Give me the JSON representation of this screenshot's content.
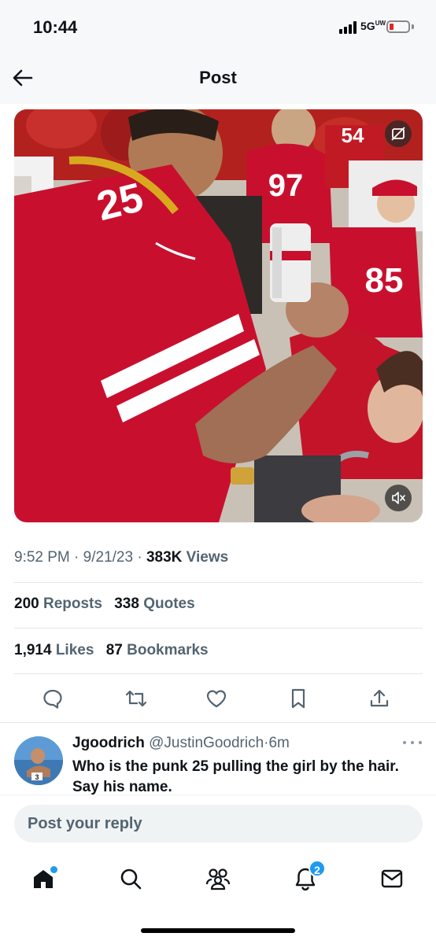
{
  "status_bar": {
    "time": "10:44",
    "network": "5G",
    "battery_level": 0.15
  },
  "header": {
    "title": "Post"
  },
  "post": {
    "media_text": {
      "jersey_main": "25",
      "jersey_97": "97",
      "jersey_54": "54",
      "jersey_85": "85"
    },
    "time": "9:52 PM",
    "date": "9/21/23",
    "views_count": "383K",
    "views_label": "Views",
    "reposts_count": "200",
    "reposts_label": "Reposts",
    "quotes_count": "338",
    "quotes_label": "Quotes",
    "likes_count": "1,914",
    "likes_label": "Likes",
    "bookmarks_count": "87",
    "bookmarks_label": "Bookmarks",
    "separator": "·"
  },
  "actions": [
    "reply-icon",
    "repost-icon",
    "like-icon",
    "bookmark-icon",
    "share-icon"
  ],
  "reply": {
    "avatar_text": "3",
    "name": "Jgoodrich",
    "handle": "@JustinGoodrich",
    "time": "6m",
    "text": "Who is the punk 25 pulling the girl by the hair. Say his name."
  },
  "composer": {
    "placeholder": "Post your reply"
  },
  "tabbar": {
    "items": [
      "home-icon",
      "search-icon",
      "communities-icon",
      "notifications-icon",
      "messages-icon"
    ],
    "notifications_badge": "2"
  },
  "colors": {
    "accent": "#1d9bf0",
    "text_primary": "#0f1419",
    "text_secondary": "#536471",
    "jersey_red": "#c8102e"
  }
}
